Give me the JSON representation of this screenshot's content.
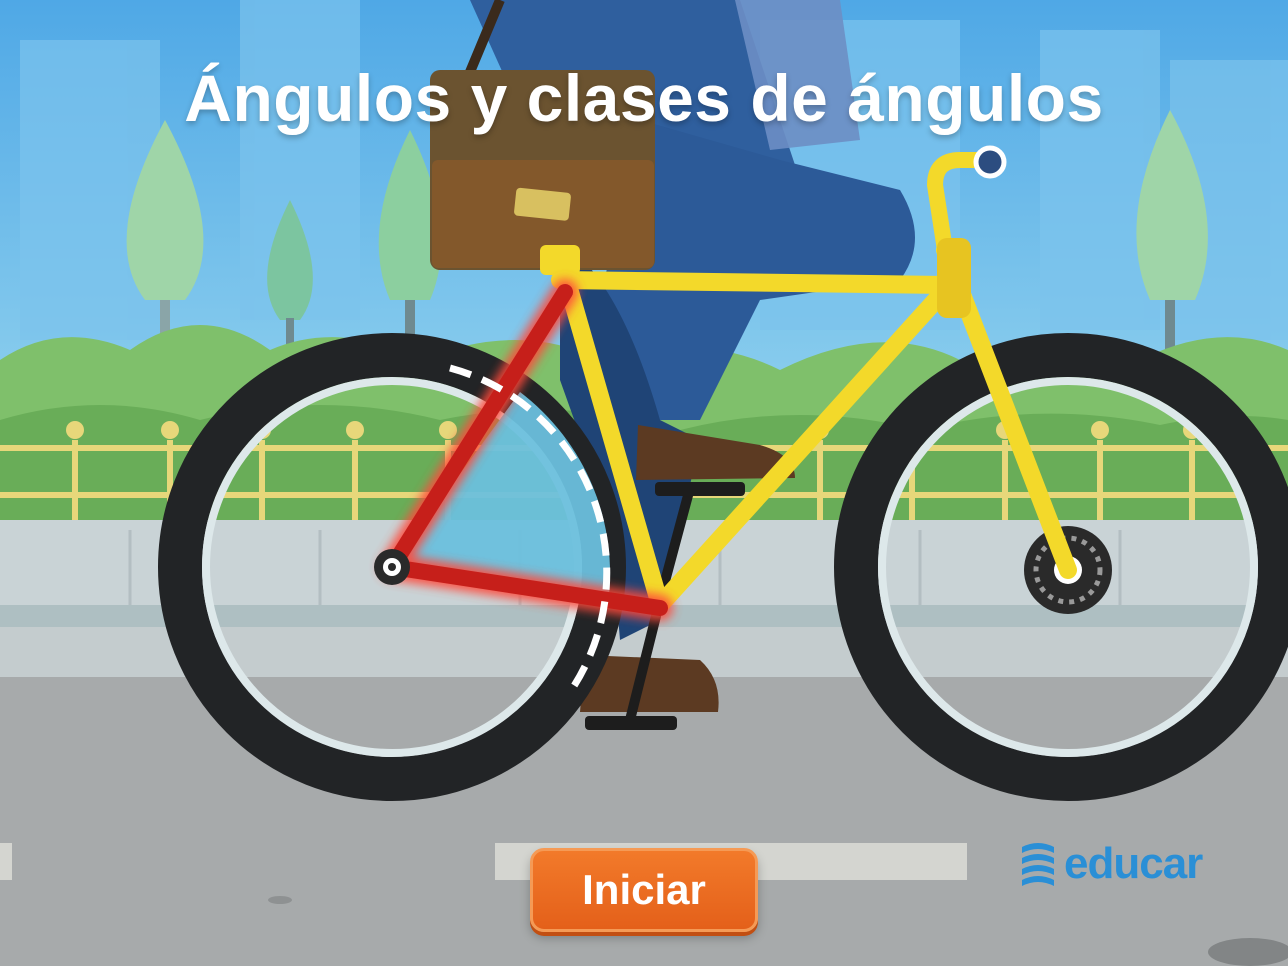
{
  "header": {
    "title": "Ángulos y clases de ángulos"
  },
  "controls": {
    "start_label": "Iniciar"
  },
  "brand": {
    "logo_text": "educar",
    "logo_icon": "educar-logo-icon"
  },
  "colors": {
    "sky": "#5fb4e8",
    "bike_frame": "#f3d92a",
    "angle_highlight": "#d0221c",
    "angle_fill": "#6cc0dd",
    "button": "#ec6a20",
    "brand": "#2a8fd6"
  }
}
